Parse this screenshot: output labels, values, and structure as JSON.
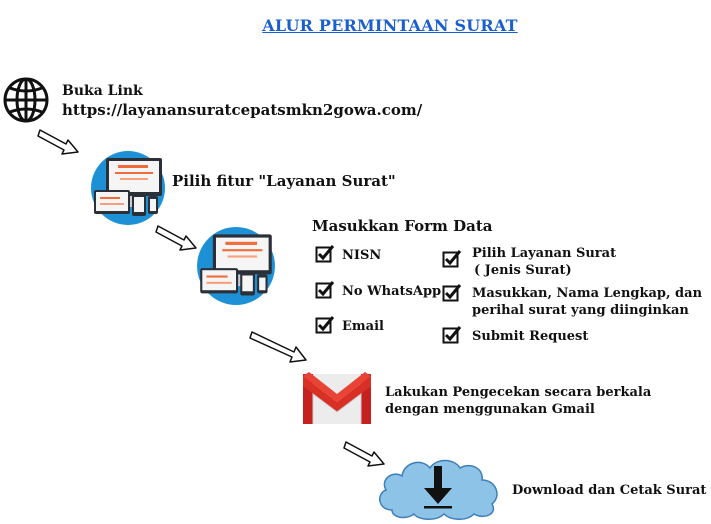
{
  "title": "ALUR PERMINTAAN SURAT",
  "steps": {
    "buka_link": {
      "label": "Buka Link",
      "url": "https://layanansuratcepatsmkn2gowa.com/"
    },
    "pilih_fitur": {
      "label": "Pilih fitur \"Layanan Surat\""
    },
    "form": {
      "heading": "Masukkan Form Data",
      "left_items": [
        "NISN",
        "No WhatsApp",
        "Email"
      ],
      "right_items": [
        [
          "Pilih Layanan Surat",
          "( Jenis Surat)"
        ],
        [
          "Masukkan, Nama Lengkap, dan",
          "perihal surat yang diinginkan"
        ],
        [
          "Submit Request"
        ]
      ]
    },
    "cek_gmail": {
      "line1": "Lakukan Pengecekan secara berkala",
      "line2": "dengan menggunakan Gmail"
    },
    "download": {
      "label": "Download dan Cetak Surat"
    }
  },
  "colors": {
    "title": "#1a5fd0",
    "circle": "#1e90d6",
    "cloud": "#8ec3e8",
    "gmail_red": "#d93025"
  },
  "icons": [
    "globe-icon",
    "devices-icon",
    "checkbox-icon",
    "gmail-icon",
    "cloud-download-icon",
    "arrow-icon"
  ]
}
